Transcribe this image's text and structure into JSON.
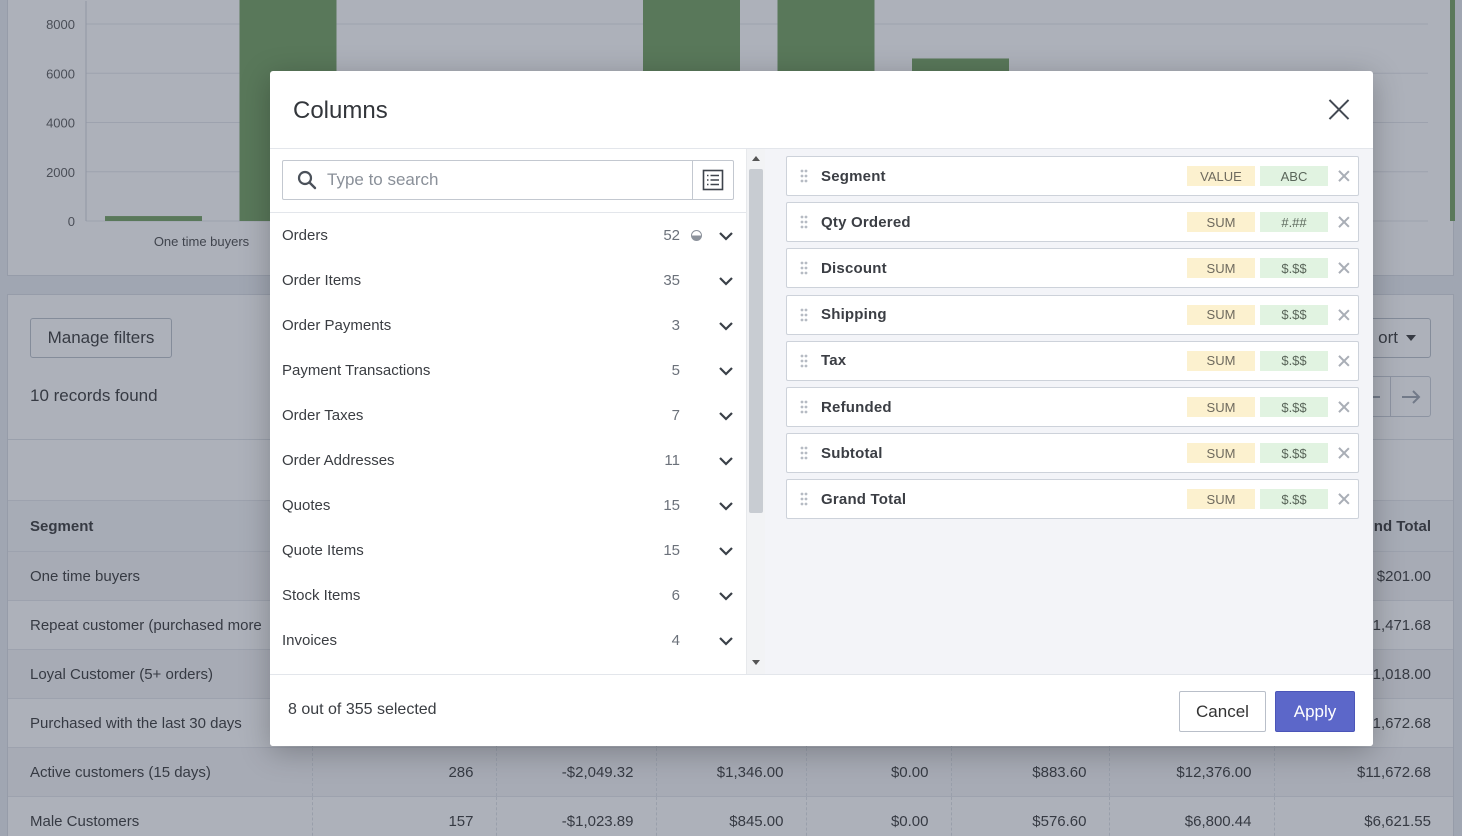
{
  "background": {
    "chart_data": {
      "type": "bar",
      "categories": [
        "One time buyers",
        "",
        "",
        "",
        "",
        "",
        "",
        "",
        "",
        ""
      ],
      "values": [
        200,
        9500,
        null,
        null,
        9500,
        9500,
        6600,
        null,
        null,
        null,
        9500,
        9500
      ],
      "ylim": [
        0,
        9000
      ],
      "yticks": [
        "8000",
        "6000",
        "4000",
        "2000",
        "0"
      ],
      "bar_color": "#6f9d5a"
    },
    "filters_button": "Manage filters",
    "records_found": "10 records found",
    "export_button_partial": "ort",
    "table": {
      "headers": [
        "Segment",
        "nd Total"
      ],
      "rows": [
        [
          "One time buyers",
          "",
          "",
          "",
          "",
          "",
          "",
          "$201.00"
        ],
        [
          "Repeat customer (purchased more",
          "",
          "",
          "",
          "",
          "",
          "",
          "1,471.68"
        ],
        [
          "Loyal Customer (5+ orders)",
          "",
          "",
          "",
          "",
          "",
          "",
          "1,018.00"
        ],
        [
          "Purchased with the last 30 days",
          "",
          "",
          "",
          "",
          "",
          "",
          "1,672.68"
        ],
        [
          "Active customers (15 days)",
          "286",
          "-$2,049.32",
          "$1,346.00",
          "$0.00",
          "$883.60",
          "$12,376.00",
          "$11,672.68"
        ],
        [
          "Male Customers",
          "157",
          "-$1,023.89",
          "$845.00",
          "$0.00",
          "$576.60",
          "$6,800.44",
          "$6,621.55"
        ]
      ]
    }
  },
  "modal": {
    "title": "Columns",
    "search": {
      "placeholder": "Type to search"
    },
    "groups": [
      {
        "label": "Orders",
        "count": "52",
        "partial": true
      },
      {
        "label": "Order Items",
        "count": "35"
      },
      {
        "label": "Order Payments",
        "count": "3"
      },
      {
        "label": "Payment Transactions",
        "count": "5"
      },
      {
        "label": "Order Taxes",
        "count": "7"
      },
      {
        "label": "Order Addresses",
        "count": "11"
      },
      {
        "label": "Quotes",
        "count": "15"
      },
      {
        "label": "Quote Items",
        "count": "15"
      },
      {
        "label": "Stock Items",
        "count": "6"
      },
      {
        "label": "Invoices",
        "count": "4"
      }
    ],
    "selected_columns": [
      {
        "label": "Segment",
        "agg": "VALUE",
        "format": "ABC"
      },
      {
        "label": "Qty Ordered",
        "agg": "SUM",
        "format": "#.##"
      },
      {
        "label": "Discount",
        "agg": "SUM",
        "format": "$.$$"
      },
      {
        "label": "Shipping",
        "agg": "SUM",
        "format": "$.$$"
      },
      {
        "label": "Tax",
        "agg": "SUM",
        "format": "$.$$"
      },
      {
        "label": "Refunded",
        "agg": "SUM",
        "format": "$.$$"
      },
      {
        "label": "Subtotal",
        "agg": "SUM",
        "format": "$.$$"
      },
      {
        "label": "Grand Total",
        "agg": "SUM",
        "format": "$.$$"
      }
    ],
    "footer": {
      "selection_count": "8 out of 355 selected",
      "cancel_label": "Cancel",
      "apply_label": "Apply"
    }
  }
}
